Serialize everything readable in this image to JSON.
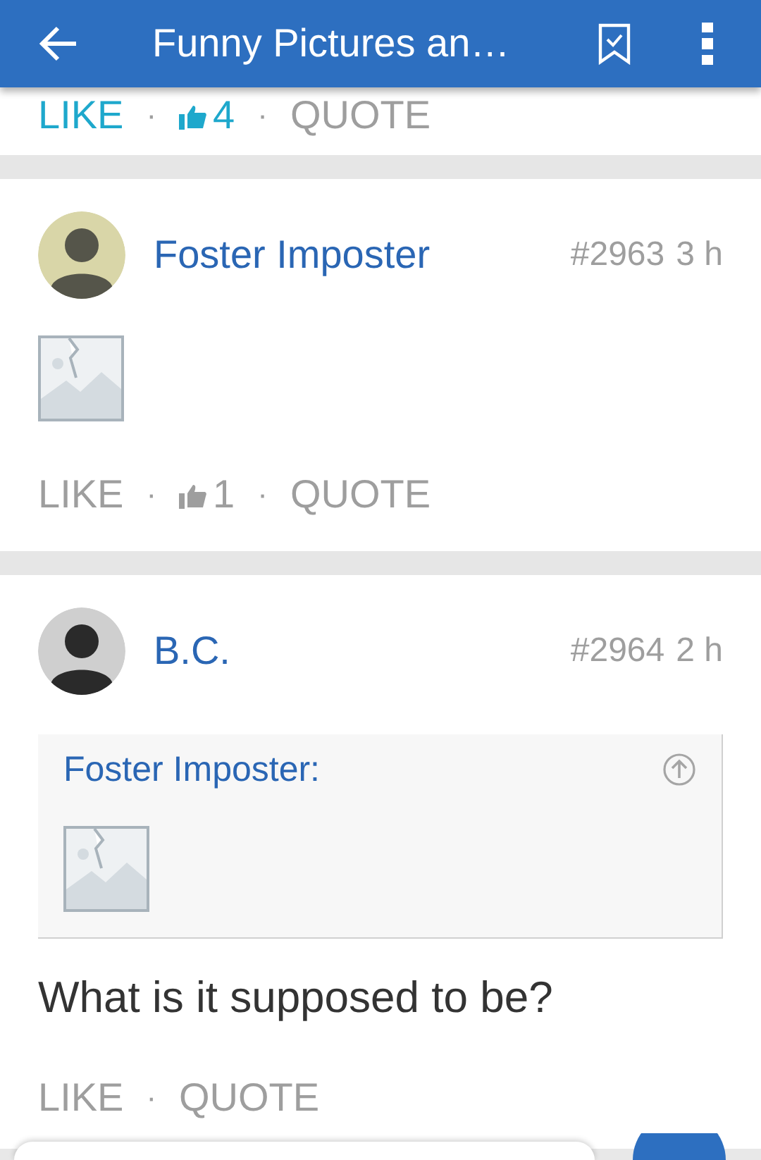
{
  "app_bar": {
    "title": "Funny Pictures an…"
  },
  "posts": [
    {
      "actions": {
        "like": "LIKE",
        "liked": true,
        "like_count": "4",
        "quote": "QUOTE",
        "dot": "·"
      }
    },
    {
      "author": "Foster Imposter",
      "number": "#2963",
      "time": "3 h",
      "body": [
        {
          "kind": "image"
        }
      ],
      "actions": {
        "like": "LIKE",
        "liked": false,
        "like_count": "1",
        "quote": "QUOTE",
        "dot": "·"
      }
    },
    {
      "author": "B.C.",
      "number": "#2964",
      "time": "2 h",
      "body": [
        {
          "kind": "quote",
          "author": "Foster Imposter:",
          "body": [
            {
              "kind": "image"
            }
          ]
        },
        {
          "kind": "text",
          "text": "What is it supposed to be?"
        }
      ],
      "actions": {
        "like": "LIKE",
        "liked": false,
        "quote": "QUOTE",
        "dot": "·"
      }
    }
  ]
}
